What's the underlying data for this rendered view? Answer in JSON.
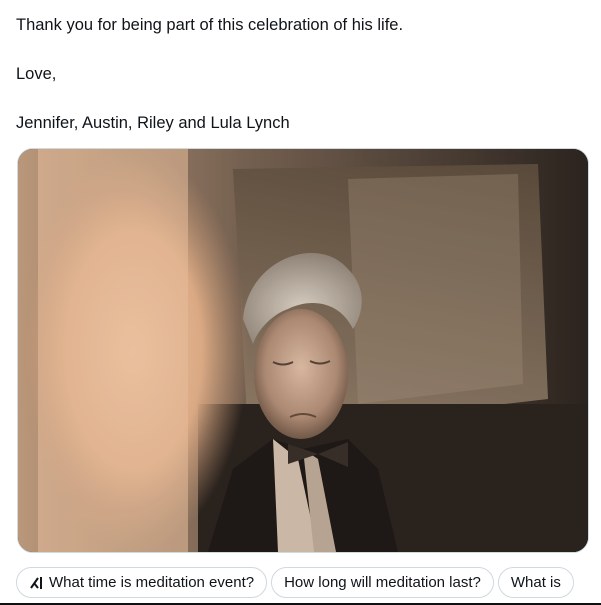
{
  "tweet": {
    "lines": [
      "Thank you for being part of this celebration of his life.",
      "Love,",
      "Jennifer, Austin, Riley and Lula Lynch"
    ]
  },
  "suggestions": [
    {
      "label": "What time is meditation event?",
      "icon": "grok-icon"
    },
    {
      "label": "How long will meditation last?"
    },
    {
      "label": "What is"
    }
  ]
}
